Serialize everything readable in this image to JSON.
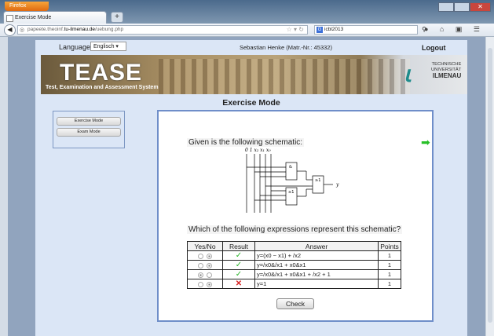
{
  "browser": {
    "app_button": "Firefox",
    "tab_title": "Exercise Mode",
    "new_tab": "+",
    "url_prefix": "papeete.theoinf.",
    "url_domain": "tu-ilmenau.de",
    "url_path": "/uebung.php",
    "search_value": "icbl2013",
    "search_engine_icon": "G"
  },
  "header": {
    "language_label": "Language:",
    "language_value": "Englisch",
    "user": "Sebastian Henke   (Matr.-Nr.: 45332)",
    "logout": "Logout"
  },
  "banner": {
    "title": "TEASE",
    "tagline": "Test, Examination and Assessment System",
    "uni_line1": "TECHNISCHE",
    "uni_line2": "UNIVERSITÄT",
    "uni_line3": "ILMENAU"
  },
  "page_title": "Exercise Mode",
  "sidebar": {
    "items": [
      {
        "label": "Exercise Mode"
      },
      {
        "label": "Exam Mode"
      }
    ]
  },
  "exercise": {
    "given": "Given is the following schematic:",
    "question": "Which of the following expressions represent this schematic?",
    "schematic_labels": {
      "inputs": "0  1  x₂ x₁ x₀",
      "and_gate": "&",
      "or_gate": "≥1",
      "output": "y"
    },
    "table": {
      "headers": [
        "Yes/No",
        "Result",
        "Answer",
        "Points"
      ],
      "rows": [
        {
          "yes": false,
          "no": true,
          "result": "correct",
          "answer": "y=(x0 ~ x1) + /x2",
          "points": "1"
        },
        {
          "yes": false,
          "no": true,
          "result": "correct",
          "answer": "y=/x0&/x1 + x0&x1",
          "points": "1"
        },
        {
          "yes": true,
          "no": false,
          "result": "correct",
          "answer": "y=/x0&/x1 + x0&x1 + /x2 + 1",
          "points": "1"
        },
        {
          "yes": false,
          "no": true,
          "result": "wrong",
          "answer": "y=1",
          "points": "1"
        }
      ]
    },
    "check_label": "Check"
  },
  "colors": {
    "accent_border": "#6f8ec9",
    "correct": "#2ab42a",
    "wrong": "#d62020",
    "page_bg": "#dbe6f6"
  }
}
